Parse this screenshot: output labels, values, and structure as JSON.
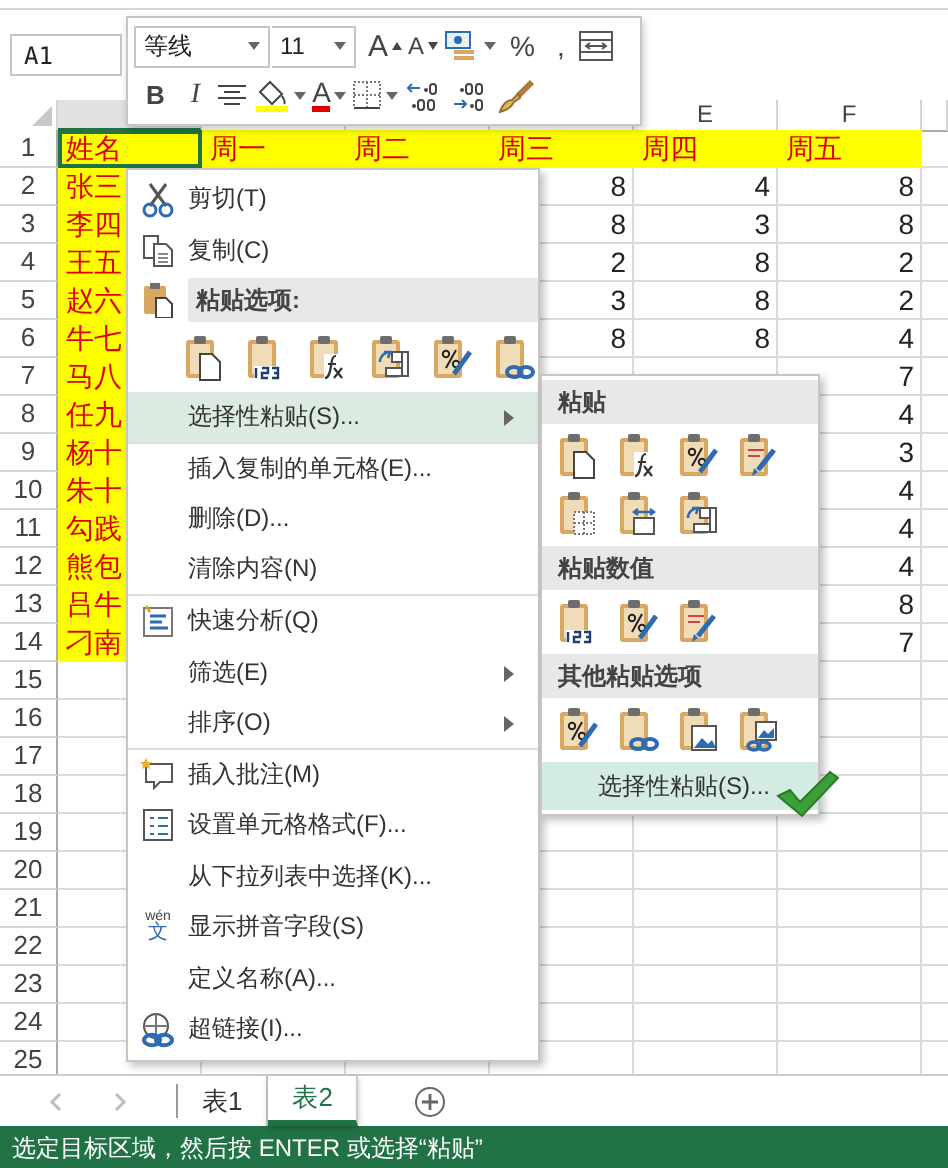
{
  "name_box": {
    "value": "A1"
  },
  "mini_toolbar": {
    "font": "等线",
    "size": "11",
    "row1": [
      {
        "kind": "grow_font",
        "label": "A"
      },
      {
        "kind": "shrink_font",
        "label": "A"
      },
      {
        "kind": "accounting"
      },
      {
        "kind": "percent",
        "label": "%"
      },
      {
        "kind": "comma",
        "label": ","
      },
      {
        "kind": "wrap"
      }
    ],
    "row2": [
      {
        "kind": "bold",
        "label": "B"
      },
      {
        "kind": "italic",
        "label": "I"
      },
      {
        "kind": "align_center"
      },
      {
        "kind": "fill_color"
      },
      {
        "kind": "font_color",
        "label": "A"
      },
      {
        "kind": "borders"
      },
      {
        "kind": "increase_decimal"
      },
      {
        "kind": "decrease_decimal"
      },
      {
        "kind": "format_painter"
      }
    ]
  },
  "column_headers": {
    "e": "E",
    "f": "F"
  },
  "rows": [
    {
      "number": "1",
      "row_filled": true,
      "name_filled": true,
      "selected": true,
      "a": "姓名",
      "b": "周一",
      "c": "周二",
      "d": "周三",
      "e": "周四",
      "f": "周五"
    },
    {
      "number": "2",
      "name_filled": true,
      "a": "张三",
      "d": "8",
      "e": "4",
      "f": "8"
    },
    {
      "number": "3",
      "name_filled": true,
      "a": "李四",
      "d": "8",
      "e": "3",
      "f": "8"
    },
    {
      "number": "4",
      "name_filled": true,
      "a": "王五",
      "d": "2",
      "e": "8",
      "f": "2"
    },
    {
      "number": "5",
      "name_filled": true,
      "a": "赵六",
      "d": "3",
      "e": "8",
      "f": "2"
    },
    {
      "number": "6",
      "name_filled": true,
      "a": "牛七",
      "d": "8",
      "e": "8",
      "f": "4"
    },
    {
      "number": "7",
      "name_filled": true,
      "a": "马八",
      "f": "7"
    },
    {
      "number": "8",
      "name_filled": true,
      "a": "任九",
      "f": "4"
    },
    {
      "number": "9",
      "name_filled": true,
      "a": "杨十",
      "f": "3"
    },
    {
      "number": "10",
      "name_filled": true,
      "a": "朱十",
      "f": "4"
    },
    {
      "number": "11",
      "name_filled": true,
      "a": "勾践",
      "f": "4"
    },
    {
      "number": "12",
      "name_filled": true,
      "a": "熊包",
      "f": "4"
    },
    {
      "number": "13",
      "name_filled": true,
      "a": "吕牛",
      "f": "8"
    },
    {
      "number": "14",
      "name_filled": true,
      "a": "刁南",
      "f": "7"
    },
    {
      "number": "15"
    },
    {
      "number": "16"
    },
    {
      "number": "17"
    },
    {
      "number": "18"
    },
    {
      "number": "19"
    },
    {
      "number": "20"
    },
    {
      "number": "21"
    },
    {
      "number": "22"
    },
    {
      "number": "23"
    },
    {
      "number": "24"
    },
    {
      "number": "25"
    }
  ],
  "context_menu": [
    {
      "kind": "cut",
      "label": "剪切(T)",
      "selected": false
    },
    {
      "kind": "copy",
      "label": "复制(C)",
      "selected": false
    },
    {
      "kind": "header",
      "label": "粘贴选项:"
    },
    {
      "kind": "icons",
      "icons": [
        {
          "kind": "page"
        },
        {
          "kind": "values"
        },
        {
          "kind": "formula"
        },
        {
          "kind": "transpose"
        },
        {
          "kind": "percent"
        },
        {
          "kind": "link"
        }
      ]
    },
    {
      "kind": "plain",
      "label": "选择性粘贴(S)...",
      "submenu": true,
      "selected": true,
      "divider_below": true
    },
    {
      "kind": "plain",
      "label": "插入复制的单元格(E)...",
      "selected": false
    },
    {
      "kind": "plain",
      "label": "删除(D)...",
      "selected": false
    },
    {
      "kind": "plain",
      "label": "清除内容(N)",
      "selected": false,
      "divider_below": true
    },
    {
      "kind": "quick_analysis",
      "label": "快速分析(Q)",
      "selected": false
    },
    {
      "kind": "plain",
      "label": "筛选(E)",
      "submenu": true,
      "selected": false
    },
    {
      "kind": "plain",
      "label": "排序(O)",
      "submenu": true,
      "selected": false,
      "divider_below": true
    },
    {
      "kind": "comment",
      "label": "插入批注(M)",
      "selected": false
    },
    {
      "kind": "format_cells",
      "label": "设置单元格格式(F)...",
      "selected": false
    },
    {
      "kind": "plain",
      "label": "从下拉列表中选择(K)...",
      "selected": false
    },
    {
      "kind": "phonetic",
      "label": "显示拼音字段(S)",
      "icon_top": "wén",
      "icon_char": "文",
      "selected": false
    },
    {
      "kind": "plain",
      "label": "定义名称(A)...",
      "selected": false
    },
    {
      "kind": "hyperlink",
      "label": "超链接(I)...",
      "selected": false
    }
  ],
  "paste_special_menu": {
    "sections": [
      {
        "title": "粘贴",
        "icons": [
          {
            "kind": "page"
          },
          {
            "kind": "formula"
          },
          {
            "kind": "percent"
          },
          {
            "kind": "brush"
          },
          {
            "kind": "no_borders"
          },
          {
            "kind": "widths"
          },
          {
            "kind": "transpose"
          }
        ]
      },
      {
        "title": "粘贴数值",
        "icons": [
          {
            "kind": "values"
          },
          {
            "kind": "percent"
          },
          {
            "kind": "brush"
          }
        ]
      },
      {
        "title": "其他粘贴选项",
        "icons": [
          {
            "kind": "percent"
          },
          {
            "kind": "link"
          },
          {
            "kind": "picture"
          },
          {
            "kind": "linked_picture"
          }
        ]
      }
    ],
    "footer": {
      "label": "选择性粘贴(S)...",
      "selected": true,
      "check_mark": true
    }
  },
  "sheet_tabs": [
    {
      "label": "表1",
      "selected": false
    },
    {
      "label": "表2",
      "selected": true
    }
  ],
  "status_bar": {
    "text": "选定目标区域，然后按 ENTER 或选择“粘贴”"
  }
}
